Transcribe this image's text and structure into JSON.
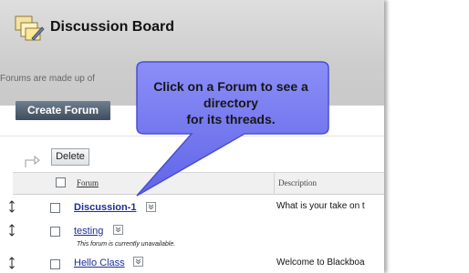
{
  "page": {
    "title": "Discussion Board",
    "description": "Forums are made up of"
  },
  "toolbar": {
    "create_forum_label": "Create Forum",
    "delete_label": "Delete"
  },
  "table": {
    "columns": [
      "Forum",
      "Description"
    ],
    "rows": [
      {
        "name": "Discussion-1",
        "description": "What is your take on t",
        "note": ""
      },
      {
        "name": "testing",
        "description": "",
        "note": "This forum is currently unavailable."
      },
      {
        "name": "Hello Class",
        "description": "Welcome to Blackboa",
        "note": ""
      }
    ]
  },
  "callout": {
    "text_line1": "Click on a Forum to see a directory",
    "text_line2": "for its threads."
  },
  "colors": {
    "callout_fill": "#6f73f2",
    "link": "#1a2e9a",
    "create_button": "#4a5868"
  },
  "icons": [
    "discussion-board-icon",
    "delete-arrow-icon",
    "drag-handle-icon",
    "chevron-down-icon"
  ]
}
